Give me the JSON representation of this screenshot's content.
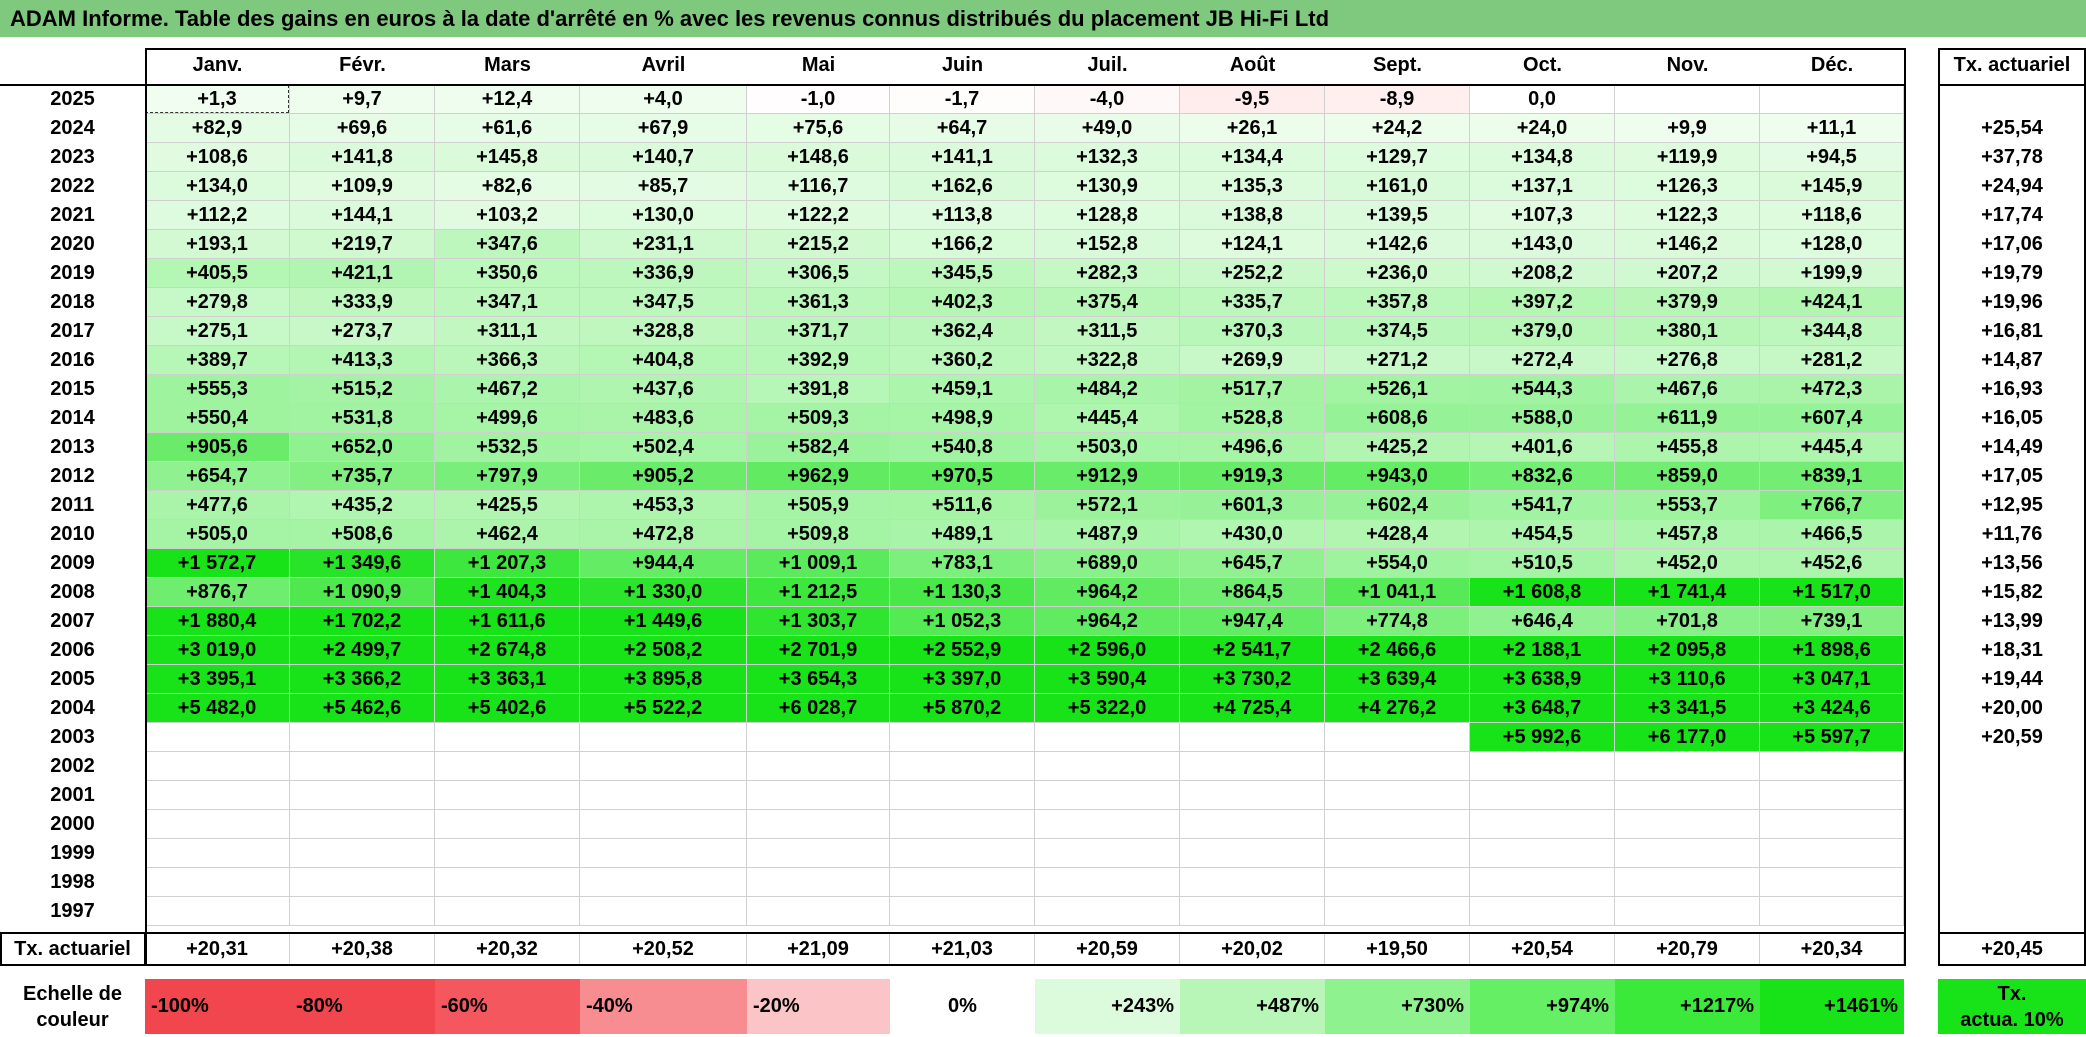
{
  "title": "ADAM Informe. Table des gains en euros à la date d'arrêté en % avec les revenus connus distribués du placement JB Hi-Fi Ltd",
  "months": [
    "Janv.",
    "Févr.",
    "Mars",
    "Avril",
    "Mai",
    "Juin",
    "Juil.",
    "Août",
    "Sept.",
    "Oct.",
    "Nov.",
    "Déc."
  ],
  "tx_header": "Tx. actuariel",
  "rows": [
    {
      "year": "2025",
      "values": [
        "+1,3",
        "+9,7",
        "+12,4",
        "+4,0",
        "-1,0",
        "-1,7",
        "-4,0",
        "-9,5",
        "-8,9",
        "0,0",
        "",
        ""
      ],
      "tx": ""
    },
    {
      "year": "2024",
      "values": [
        "+82,9",
        "+69,6",
        "+61,6",
        "+67,9",
        "+75,6",
        "+64,7",
        "+49,0",
        "+26,1",
        "+24,2",
        "+24,0",
        "+9,9",
        "+11,1"
      ],
      "tx": "+25,54"
    },
    {
      "year": "2023",
      "values": [
        "+108,6",
        "+141,8",
        "+145,8",
        "+140,7",
        "+148,6",
        "+141,1",
        "+132,3",
        "+134,4",
        "+129,7",
        "+134,8",
        "+119,9",
        "+94,5"
      ],
      "tx": "+37,78"
    },
    {
      "year": "2022",
      "values": [
        "+134,0",
        "+109,9",
        "+82,6",
        "+85,7",
        "+116,7",
        "+162,6",
        "+130,9",
        "+135,3",
        "+161,0",
        "+137,1",
        "+126,3",
        "+145,9"
      ],
      "tx": "+24,94"
    },
    {
      "year": "2021",
      "values": [
        "+112,2",
        "+144,1",
        "+103,2",
        "+130,0",
        "+122,2",
        "+113,8",
        "+128,8",
        "+138,8",
        "+139,5",
        "+107,3",
        "+122,3",
        "+118,6"
      ],
      "tx": "+17,74"
    },
    {
      "year": "2020",
      "values": [
        "+193,1",
        "+219,7",
        "+347,6",
        "+231,1",
        "+215,2",
        "+166,2",
        "+152,8",
        "+124,1",
        "+142,6",
        "+143,0",
        "+146,2",
        "+128,0"
      ],
      "tx": "+17,06"
    },
    {
      "year": "2019",
      "values": [
        "+405,5",
        "+421,1",
        "+350,6",
        "+336,9",
        "+306,5",
        "+345,5",
        "+282,3",
        "+252,2",
        "+236,0",
        "+208,2",
        "+207,2",
        "+199,9"
      ],
      "tx": "+19,79"
    },
    {
      "year": "2018",
      "values": [
        "+279,8",
        "+333,9",
        "+347,1",
        "+347,5",
        "+361,3",
        "+402,3",
        "+375,4",
        "+335,7",
        "+357,8",
        "+397,2",
        "+379,9",
        "+424,1"
      ],
      "tx": "+19,96"
    },
    {
      "year": "2017",
      "values": [
        "+275,1",
        "+273,7",
        "+311,1",
        "+328,8",
        "+371,7",
        "+362,4",
        "+311,5",
        "+370,3",
        "+374,5",
        "+379,0",
        "+380,1",
        "+344,8"
      ],
      "tx": "+16,81"
    },
    {
      "year": "2016",
      "values": [
        "+389,7",
        "+413,3",
        "+366,3",
        "+404,8",
        "+392,9",
        "+360,2",
        "+322,8",
        "+269,9",
        "+271,2",
        "+272,4",
        "+276,8",
        "+281,2"
      ],
      "tx": "+14,87"
    },
    {
      "year": "2015",
      "values": [
        "+555,3",
        "+515,2",
        "+467,2",
        "+437,6",
        "+391,8",
        "+459,1",
        "+484,2",
        "+517,7",
        "+526,1",
        "+544,3",
        "+467,6",
        "+472,3"
      ],
      "tx": "+16,93"
    },
    {
      "year": "2014",
      "values": [
        "+550,4",
        "+531,8",
        "+499,6",
        "+483,6",
        "+509,3",
        "+498,9",
        "+445,4",
        "+528,8",
        "+608,6",
        "+588,0",
        "+611,9",
        "+607,4"
      ],
      "tx": "+16,05"
    },
    {
      "year": "2013",
      "values": [
        "+905,6",
        "+652,0",
        "+532,5",
        "+502,4",
        "+582,4",
        "+540,8",
        "+503,0",
        "+496,6",
        "+425,2",
        "+401,6",
        "+455,8",
        "+445,4"
      ],
      "tx": "+14,49"
    },
    {
      "year": "2012",
      "values": [
        "+654,7",
        "+735,7",
        "+797,9",
        "+905,2",
        "+962,9",
        "+970,5",
        "+912,9",
        "+919,3",
        "+943,0",
        "+832,6",
        "+859,0",
        "+839,1"
      ],
      "tx": "+17,05"
    },
    {
      "year": "2011",
      "values": [
        "+477,6",
        "+435,2",
        "+425,5",
        "+453,3",
        "+505,9",
        "+511,6",
        "+572,1",
        "+601,3",
        "+602,4",
        "+541,7",
        "+553,7",
        "+766,7"
      ],
      "tx": "+12,95"
    },
    {
      "year": "2010",
      "values": [
        "+505,0",
        "+508,6",
        "+462,4",
        "+472,8",
        "+509,8",
        "+489,1",
        "+487,9",
        "+430,0",
        "+428,4",
        "+454,5",
        "+457,8",
        "+466,5"
      ],
      "tx": "+11,76"
    },
    {
      "year": "2009",
      "values": [
        "+1 572,7",
        "+1 349,6",
        "+1 207,3",
        "+944,4",
        "+1 009,1",
        "+783,1",
        "+689,0",
        "+645,7",
        "+554,0",
        "+510,5",
        "+452,0",
        "+452,6"
      ],
      "tx": "+13,56"
    },
    {
      "year": "2008",
      "values": [
        "+876,7",
        "+1 090,9",
        "+1 404,3",
        "+1 330,0",
        "+1 212,5",
        "+1 130,3",
        "+964,2",
        "+864,5",
        "+1 041,1",
        "+1 608,8",
        "+1 741,4",
        "+1 517,0"
      ],
      "tx": "+15,82"
    },
    {
      "year": "2007",
      "values": [
        "+1 880,4",
        "+1 702,2",
        "+1 611,6",
        "+1 449,6",
        "+1 303,7",
        "+1 052,3",
        "+964,2",
        "+947,4",
        "+774,8",
        "+646,4",
        "+701,8",
        "+739,1"
      ],
      "tx": "+13,99"
    },
    {
      "year": "2006",
      "values": [
        "+3 019,0",
        "+2 499,7",
        "+2 674,8",
        "+2 508,2",
        "+2 701,9",
        "+2 552,9",
        "+2 596,0",
        "+2 541,7",
        "+2 466,6",
        "+2 188,1",
        "+2 095,8",
        "+1 898,6"
      ],
      "tx": "+18,31"
    },
    {
      "year": "2005",
      "values": [
        "+3 395,1",
        "+3 366,2",
        "+3 363,1",
        "+3 895,8",
        "+3 654,3",
        "+3 397,0",
        "+3 590,4",
        "+3 730,2",
        "+3 639,4",
        "+3 638,9",
        "+3 110,6",
        "+3 047,1"
      ],
      "tx": "+19,44"
    },
    {
      "year": "2004",
      "values": [
        "+5 482,0",
        "+5 462,6",
        "+5 402,6",
        "+5 522,2",
        "+6 028,7",
        "+5 870,2",
        "+5 322,0",
        "+4 725,4",
        "+4 276,2",
        "+3 648,7",
        "+3 341,5",
        "+3 424,6"
      ],
      "tx": "+20,00"
    },
    {
      "year": "2003",
      "values": [
        "",
        "",
        "",
        "",
        "",
        "",
        "",
        "",
        "",
        "+5 992,6",
        "+6 177,0",
        "+5 597,7"
      ],
      "tx": "+20,59"
    },
    {
      "year": "2002",
      "values": [
        "",
        "",
        "",
        "",
        "",
        "",
        "",
        "",
        "",
        "",
        "",
        ""
      ],
      "tx": ""
    },
    {
      "year": "2001",
      "values": [
        "",
        "",
        "",
        "",
        "",
        "",
        "",
        "",
        "",
        "",
        "",
        ""
      ],
      "tx": ""
    },
    {
      "year": "2000",
      "values": [
        "",
        "",
        "",
        "",
        "",
        "",
        "",
        "",
        "",
        "",
        "",
        ""
      ],
      "tx": ""
    },
    {
      "year": "1999",
      "values": [
        "",
        "",
        "",
        "",
        "",
        "",
        "",
        "",
        "",
        "",
        "",
        ""
      ],
      "tx": ""
    },
    {
      "year": "1998",
      "values": [
        "",
        "",
        "",
        "",
        "",
        "",
        "",
        "",
        "",
        "",
        "",
        ""
      ],
      "tx": ""
    },
    {
      "year": "1997",
      "values": [
        "",
        "",
        "",
        "",
        "",
        "",
        "",
        "",
        "",
        "",
        "",
        ""
      ],
      "tx": ""
    }
  ],
  "tx_row": {
    "label": "Tx. actuariel",
    "values": [
      "+20,31",
      "+20,38",
      "+20,32",
      "+20,52",
      "+21,09",
      "+21,03",
      "+20,59",
      "+20,02",
      "+19,50",
      "+20,54",
      "+20,79",
      "+20,34"
    ],
    "total": "+20,45"
  },
  "scale": {
    "label_1": "Echelle de",
    "label_2": "couleur",
    "items": [
      {
        "label": "-100%",
        "color": "#f2464e",
        "align": "left"
      },
      {
        "label": "-80%",
        "color": "#f2464e",
        "align": "left"
      },
      {
        "label": "-60%",
        "color": "#f4585e",
        "align": "left"
      },
      {
        "label": "-40%",
        "color": "#f78d90",
        "align": "left"
      },
      {
        "label": "-20%",
        "color": "#fbc4c6",
        "align": "left"
      },
      {
        "label": "0%",
        "color": "#ffffff",
        "align": "center"
      },
      {
        "label": "+243%",
        "color": "#dcfadc",
        "align": "right"
      },
      {
        "label": "+487%",
        "color": "#b8f6b8",
        "align": "right"
      },
      {
        "label": "+730%",
        "color": "#8ef38e",
        "align": "right"
      },
      {
        "label": "+974%",
        "color": "#64ef64",
        "align": "right"
      },
      {
        "label": "+1217%",
        "color": "#3be93b",
        "align": "right"
      },
      {
        "label": "+1461%",
        "color": "#18e218",
        "align": "right"
      }
    ],
    "tx_label_1": "Tx.",
    "tx_label_2": "actua. 10%",
    "tx_color": "#18e218"
  },
  "colors": {
    "title_bg": "#7fc97f",
    "max_green": "#00e000",
    "neg_red": "#f2464e"
  }
}
